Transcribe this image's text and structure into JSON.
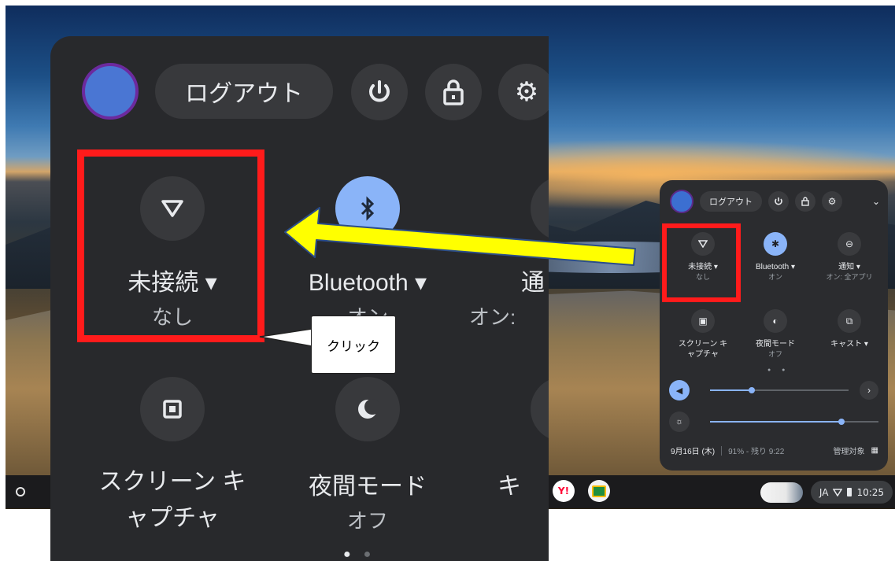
{
  "zoomed_panel": {
    "logout_label": "ログアウト",
    "tiles": [
      {
        "label": "未接続 ▾",
        "sublabel": "なし",
        "icon": "wifi-icon"
      },
      {
        "label": "Bluetooth ▾",
        "sublabel": "オン",
        "icon": "bluetooth-icon"
      },
      {
        "label": "通",
        "sublabel": "オン:",
        "icon": "notification-icon"
      },
      {
        "label": "スクリーン キ",
        "label2": "ャプチャ",
        "icon": "screen-capture-icon"
      },
      {
        "label": "夜間モード",
        "sublabel": "オフ",
        "icon": "night-light-icon"
      },
      {
        "label": "キ",
        "icon": "cast-icon"
      }
    ]
  },
  "small_panel": {
    "logout_label": "ログアウト",
    "tiles": [
      {
        "label": "未接続 ▾",
        "sublabel": "なし"
      },
      {
        "label": "Bluetooth ▾",
        "sublabel": "オン"
      },
      {
        "label": "通知 ▾",
        "sublabel": "オン: 全アプリ"
      },
      {
        "label": "スクリーン キ",
        "label2": "ャプチャ"
      },
      {
        "label": "夜間モード",
        "sublabel": "オフ"
      },
      {
        "label": "キャスト ▾"
      }
    ],
    "volume_level": 0.3,
    "brightness_level": 0.78,
    "footer": {
      "date": "9月16日 (木)",
      "battery": "91% - 残り 9:22",
      "managed": "管理対象"
    }
  },
  "shelf": {
    "yahoo_label": "Y!",
    "status": {
      "ime": "JA",
      "time": "10:25"
    }
  },
  "annotation": {
    "callout_text": "クリック"
  },
  "colors": {
    "highlight": "#ff1b1b",
    "arrow_fill": "#ffff00",
    "toggle_on": "#8ab4f8"
  }
}
